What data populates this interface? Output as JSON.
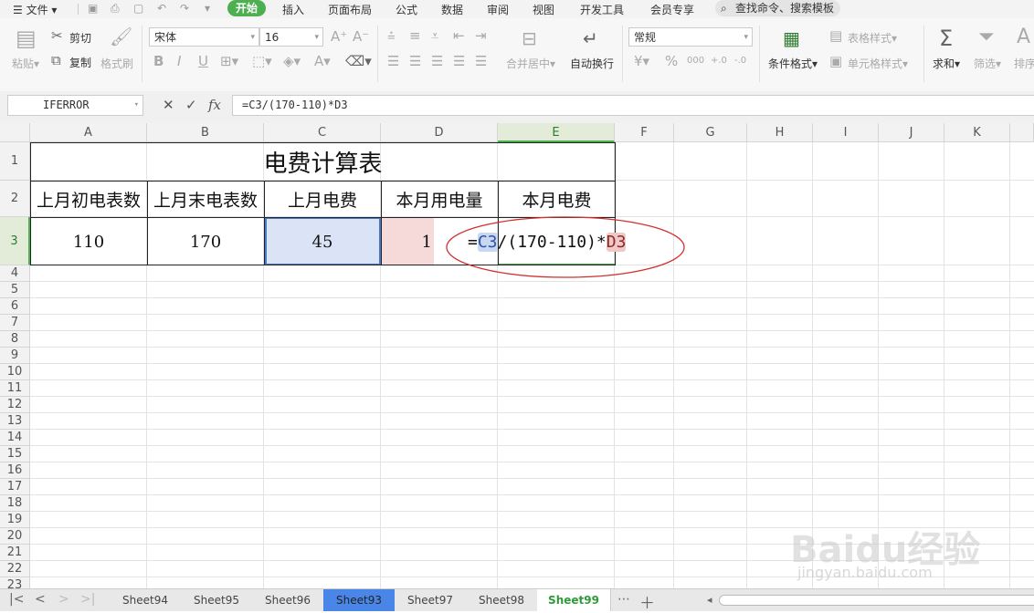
{
  "menu": {
    "file": "文件",
    "tabs": [
      "开始",
      "插入",
      "页面布局",
      "公式",
      "数据",
      "审阅",
      "视图",
      "开发工具",
      "会员专享"
    ],
    "search": "查找命令、搜索模板"
  },
  "ribbon": {
    "paste": "粘贴",
    "cut": "剪切",
    "copy": "复制",
    "format_painter": "格式刷",
    "font_name": "宋体",
    "font_size": "16",
    "merge_center": "合并居中",
    "wrap_text": "自动换行",
    "number_format": "常规",
    "conditional_format": "条件格式",
    "table_style": "表格样式",
    "cell_style": "单元格样式",
    "sum": "求和",
    "filter": "筛选",
    "sort": "排序"
  },
  "formula_bar": {
    "name_box": "IFERROR",
    "fx": "fx",
    "formula": "=C3/(170-110)*D3"
  },
  "columns": [
    "A",
    "B",
    "C",
    "D",
    "E",
    "F",
    "G",
    "H",
    "I",
    "J",
    "K"
  ],
  "rows": [
    "1",
    "2",
    "3",
    "4",
    "5",
    "6",
    "7",
    "8",
    "9",
    "10",
    "11",
    "12",
    "13",
    "14",
    "15",
    "16",
    "17",
    "18",
    "19",
    "20",
    "21",
    "22",
    "23"
  ],
  "table": {
    "title": "电费计算表",
    "headers": [
      "上月初电表数",
      "上月末电表数",
      "上月电费",
      "本月用电量",
      "本月电费"
    ],
    "values": [
      "110",
      "170",
      "45",
      "1"
    ],
    "edit_formula": {
      "eq": "=",
      "ref1": "C3",
      "mid": "/(170-110)*",
      "ref2": "D3"
    }
  },
  "sheet_tabs": [
    "Sheet94",
    "Sheet95",
    "Sheet96",
    "Sheet93",
    "Sheet97",
    "Sheet98",
    "Sheet99"
  ],
  "active_sheet": "Sheet99",
  "watermark": "Baidu经验",
  "watermark_url": "jingyan.baidu.com",
  "colors": {
    "accent": "#4caf50",
    "ref_blue": "#dbe4f7",
    "ref_red": "#f6d9d9",
    "circle": "#d32f2f"
  }
}
